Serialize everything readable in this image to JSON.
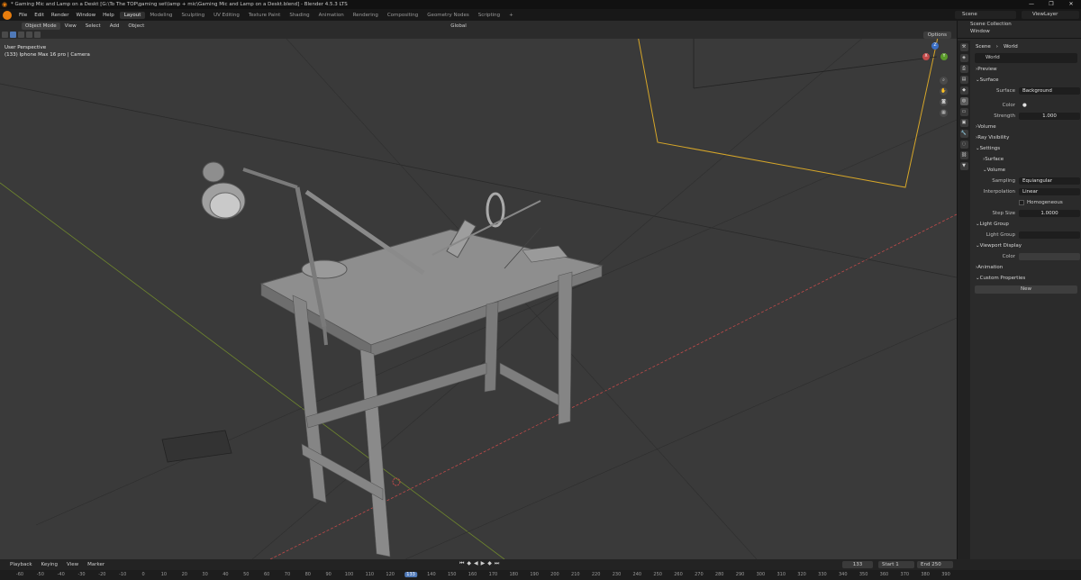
{
  "window": {
    "title": "* Gaming Mic and Lamp on a Deskt [G:\\To The TOP\\gaming set\\lamp + mic\\Gaming Mic and Lamp on a Deskt.blend] - Blender 4.5.3 LTS",
    "controls": [
      "—",
      "❐",
      "✕"
    ]
  },
  "menu": [
    "File",
    "Edit",
    "Render",
    "Window",
    "Help"
  ],
  "workspace_tabs": [
    "Layout",
    "Modeling",
    "Sculpting",
    "UV Editing",
    "Texture Paint",
    "Shading",
    "Animation",
    "Rendering",
    "Compositing",
    "Geometry Nodes",
    "Scripting",
    "+"
  ],
  "active_tab": "Layout",
  "scene_selector": "Scene",
  "viewlayer_selector": "ViewLayer",
  "viewport": {
    "mode": "Object Mode",
    "header_menus": [
      "View",
      "Select",
      "Add",
      "Object"
    ],
    "orientation": "Global",
    "options_label": "Options",
    "info_line1": "User Perspective",
    "info_line2": "(133) Iphone Max 16 pro | Camera"
  },
  "outliner": {
    "row1": "Scene Collection",
    "row2": "Window"
  },
  "properties": {
    "breadcrumb_scene": "Scene",
    "breadcrumb_world": "World",
    "world_name": "World",
    "panels": {
      "preview": "Preview",
      "surface": "Surface",
      "surface_label": "Surface",
      "surface_value": "Background",
      "color_label": "Color",
      "strength_label": "Strength",
      "strength_value": "1.000",
      "volume": "Volume",
      "ray_visibility": "Ray Visibility",
      "settings": "Settings",
      "settings_surface": "Surface",
      "settings_volume": "Volume",
      "sampling_label": "Sampling",
      "sampling_value": "Equiangular",
      "interpolation_label": "Interpolation",
      "interpolation_value": "Linear",
      "homogeneous_label": "Homogeneous",
      "step_size_label": "Step Size",
      "step_size_value": "1.0000",
      "light_group": "Light Group",
      "light_group_label": "Light Group",
      "viewport_display": "Viewport Display",
      "vd_color_label": "Color",
      "animation": "Animation",
      "custom_properties": "Custom Properties",
      "new_button": "New"
    }
  },
  "timeline": {
    "menus": [
      "Playback",
      "Keying",
      "View",
      "Marker"
    ],
    "current_frame": "133",
    "start_label": "Start",
    "start_value": "1",
    "end_label": "End",
    "end_value": "250",
    "ruler_ticks": [
      "-60",
      "-50",
      "-40",
      "-30",
      "-20",
      "-10",
      "0",
      "10",
      "20",
      "30",
      "40",
      "50",
      "60",
      "70",
      "80",
      "90",
      "100",
      "110",
      "120",
      "133",
      "140",
      "150",
      "160",
      "170",
      "180",
      "190",
      "200",
      "210",
      "220",
      "230",
      "240",
      "250",
      "260",
      "270",
      "280",
      "290",
      "300",
      "310",
      "320",
      "330",
      "340",
      "350",
      "360",
      "370",
      "380",
      "390"
    ]
  },
  "colors": {
    "accent_blue": "#4f79b8",
    "blender_orange": "#e87d0d",
    "camera_frame": "#d6a629",
    "x_axis": "#c24a4a",
    "y_axis": "#7c9a2a"
  }
}
